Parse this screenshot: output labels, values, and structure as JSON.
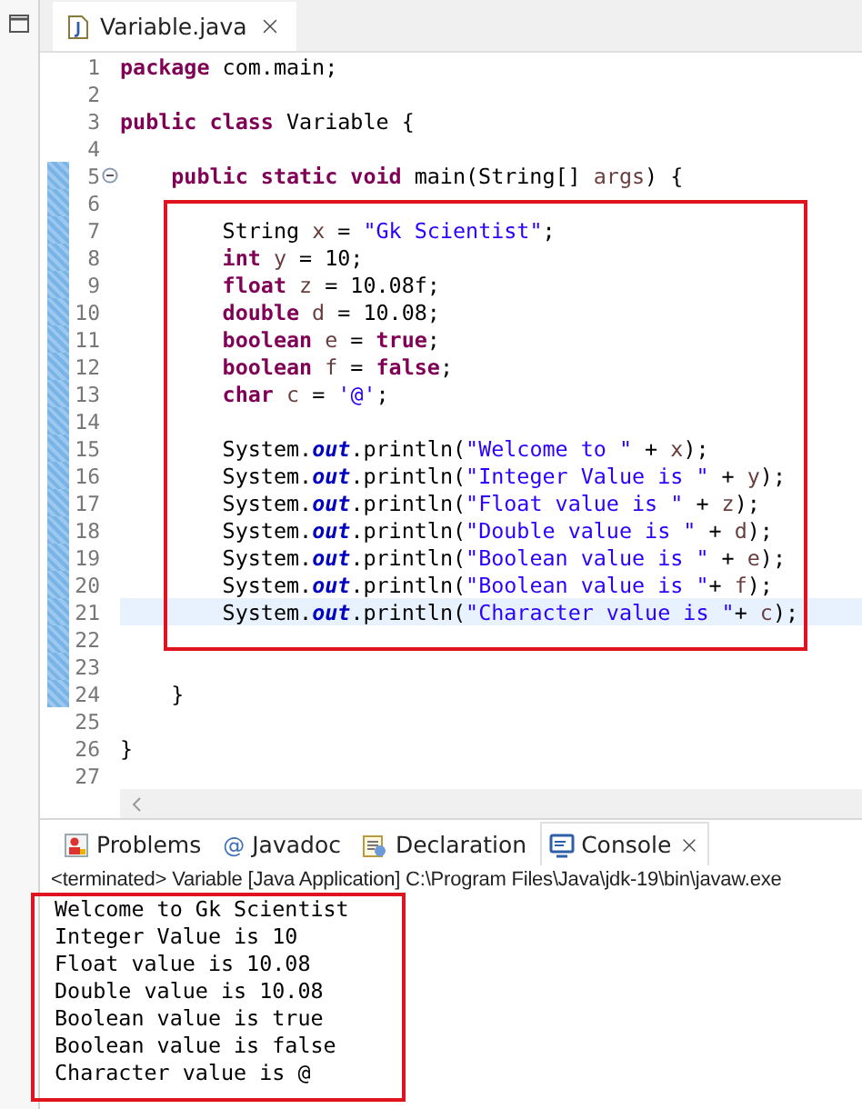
{
  "editor": {
    "tab": {
      "label": "Variable.java",
      "selected": true
    },
    "lines": [
      {
        "number": "1",
        "changed": false,
        "current": false,
        "tokens": [
          {
            "kind": "kw",
            "text": "package"
          },
          {
            "kind": "plain",
            "text": " com.main;"
          }
        ]
      },
      {
        "number": "2",
        "changed": false,
        "current": false
      },
      {
        "number": "3",
        "changed": false,
        "current": false,
        "tokens": [
          {
            "kind": "kw",
            "text": "public class"
          },
          {
            "kind": "plain",
            "text": " Variable {"
          }
        ]
      },
      {
        "number": "4",
        "changed": false,
        "current": false
      },
      {
        "number": "5",
        "changed": true,
        "current": false,
        "foldable": true,
        "tokens": [
          {
            "kind": "kw",
            "text": "    public static void"
          },
          {
            "kind": "plain",
            "text": " main(String[] "
          },
          {
            "kind": "var",
            "text": "args"
          },
          {
            "kind": "plain",
            "text": ") {"
          }
        ]
      },
      {
        "number": "6",
        "changed": true,
        "current": false
      },
      {
        "number": "7",
        "changed": true,
        "current": false,
        "tokens": [
          {
            "kind": "plain",
            "text": "        String "
          },
          {
            "kind": "var",
            "text": "x"
          },
          {
            "kind": "plain",
            "text": " = "
          },
          {
            "kind": "str",
            "text": "\"Gk Scientist\""
          },
          {
            "kind": "plain",
            "text": ";"
          }
        ]
      },
      {
        "number": "8",
        "changed": true,
        "current": false,
        "tokens": [
          {
            "kind": "kw",
            "text": "        int"
          },
          {
            "kind": "var",
            "text": " y"
          },
          {
            "kind": "plain",
            "text": " = 10;"
          }
        ]
      },
      {
        "number": "9",
        "changed": true,
        "current": false,
        "tokens": [
          {
            "kind": "kw",
            "text": "        float"
          },
          {
            "kind": "var",
            "text": " z"
          },
          {
            "kind": "plain",
            "text": " = 10.08f;"
          }
        ]
      },
      {
        "number": "10",
        "changed": true,
        "current": false,
        "tokens": [
          {
            "kind": "kw",
            "text": "        double"
          },
          {
            "kind": "var",
            "text": " d"
          },
          {
            "kind": "plain",
            "text": " = 10.08;"
          }
        ]
      },
      {
        "number": "11",
        "changed": true,
        "current": false,
        "tokens": [
          {
            "kind": "kw",
            "text": "        boolean"
          },
          {
            "kind": "var",
            "text": " e"
          },
          {
            "kind": "plain",
            "text": " = "
          },
          {
            "kind": "kw",
            "text": "true"
          },
          {
            "kind": "plain",
            "text": ";"
          }
        ]
      },
      {
        "number": "12",
        "changed": true,
        "current": false,
        "tokens": [
          {
            "kind": "kw",
            "text": "        boolean"
          },
          {
            "kind": "var",
            "text": " f"
          },
          {
            "kind": "plain",
            "text": " = "
          },
          {
            "kind": "kw",
            "text": "false"
          },
          {
            "kind": "plain",
            "text": ";"
          }
        ]
      },
      {
        "number": "13",
        "changed": true,
        "current": false,
        "tokens": [
          {
            "kind": "kw",
            "text": "        char"
          },
          {
            "kind": "var",
            "text": " c"
          },
          {
            "kind": "plain",
            "text": " = "
          },
          {
            "kind": "str",
            "text": "'@'"
          },
          {
            "kind": "plain",
            "text": ";"
          }
        ]
      },
      {
        "number": "14",
        "changed": true,
        "current": false
      },
      {
        "number": "15",
        "changed": true,
        "current": false,
        "tokens": [
          {
            "kind": "plain",
            "text": "        System."
          },
          {
            "kind": "field",
            "text": "out"
          },
          {
            "kind": "plain",
            "text": ".println("
          },
          {
            "kind": "str",
            "text": "\"Welcome to \""
          },
          {
            "kind": "plain",
            "text": " + "
          },
          {
            "kind": "var",
            "text": "x"
          },
          {
            "kind": "plain",
            "text": ");"
          }
        ]
      },
      {
        "number": "16",
        "changed": true,
        "current": false,
        "tokens": [
          {
            "kind": "plain",
            "text": "        System."
          },
          {
            "kind": "field",
            "text": "out"
          },
          {
            "kind": "plain",
            "text": ".println("
          },
          {
            "kind": "str",
            "text": "\"Integer Value is \""
          },
          {
            "kind": "plain",
            "text": " + "
          },
          {
            "kind": "var",
            "text": "y"
          },
          {
            "kind": "plain",
            "text": ");"
          }
        ]
      },
      {
        "number": "17",
        "changed": true,
        "current": false,
        "tokens": [
          {
            "kind": "plain",
            "text": "        System."
          },
          {
            "kind": "field",
            "text": "out"
          },
          {
            "kind": "plain",
            "text": ".println("
          },
          {
            "kind": "str",
            "text": "\"Float value is \""
          },
          {
            "kind": "plain",
            "text": " + "
          },
          {
            "kind": "var",
            "text": "z"
          },
          {
            "kind": "plain",
            "text": ");"
          }
        ]
      },
      {
        "number": "18",
        "changed": true,
        "current": false,
        "tokens": [
          {
            "kind": "plain",
            "text": "        System."
          },
          {
            "kind": "field",
            "text": "out"
          },
          {
            "kind": "plain",
            "text": ".println("
          },
          {
            "kind": "str",
            "text": "\"Double value is \""
          },
          {
            "kind": "plain",
            "text": " + "
          },
          {
            "kind": "var",
            "text": "d"
          },
          {
            "kind": "plain",
            "text": ");"
          }
        ]
      },
      {
        "number": "19",
        "changed": true,
        "current": false,
        "tokens": [
          {
            "kind": "plain",
            "text": "        System."
          },
          {
            "kind": "field",
            "text": "out"
          },
          {
            "kind": "plain",
            "text": ".println("
          },
          {
            "kind": "str",
            "text": "\"Boolean value is \""
          },
          {
            "kind": "plain",
            "text": " + "
          },
          {
            "kind": "var",
            "text": "e"
          },
          {
            "kind": "plain",
            "text": ");"
          }
        ]
      },
      {
        "number": "20",
        "changed": true,
        "current": false,
        "tokens": [
          {
            "kind": "plain",
            "text": "        System."
          },
          {
            "kind": "field",
            "text": "out"
          },
          {
            "kind": "plain",
            "text": ".println("
          },
          {
            "kind": "str",
            "text": "\"Boolean value is \""
          },
          {
            "kind": "plain",
            "text": "+ "
          },
          {
            "kind": "var",
            "text": "f"
          },
          {
            "kind": "plain",
            "text": ");"
          }
        ]
      },
      {
        "number": "21",
        "changed": true,
        "current": true,
        "tokens": [
          {
            "kind": "plain",
            "text": "        System."
          },
          {
            "kind": "field",
            "text": "out"
          },
          {
            "kind": "plain",
            "text": ".println("
          },
          {
            "kind": "str",
            "text": "\"Character value is \""
          },
          {
            "kind": "plain",
            "text": "+ "
          },
          {
            "kind": "var",
            "text": "c"
          },
          {
            "kind": "plain",
            "text": ");"
          }
        ]
      },
      {
        "number": "22",
        "changed": true,
        "current": false
      },
      {
        "number": "23",
        "changed": true,
        "current": false
      },
      {
        "number": "24",
        "changed": true,
        "current": false,
        "tokens": [
          {
            "kind": "plain",
            "text": "    }"
          }
        ]
      },
      {
        "number": "25",
        "changed": false,
        "current": false
      },
      {
        "number": "26",
        "changed": false,
        "current": false,
        "tokens": [
          {
            "kind": "plain",
            "text": "}"
          }
        ]
      },
      {
        "number": "27",
        "changed": false,
        "current": false
      }
    ]
  },
  "console": {
    "tabs": [
      {
        "label": "Problems",
        "kind": "problems",
        "selected": false
      },
      {
        "label": "Javadoc",
        "kind": "javadoc",
        "glyph": "@",
        "selected": false
      },
      {
        "label": "Declaration",
        "kind": "declaration",
        "selected": false
      },
      {
        "label": "Console",
        "kind": "console",
        "selected": true
      }
    ],
    "status": "<terminated> Variable [Java Application] C:\\Program Files\\Java\\jdk-19\\bin\\javaw.exe",
    "output": [
      "Welcome to Gk Scientist",
      "Integer Value is 10",
      "Float value is 10.08",
      "Double value is 10.08",
      "Boolean value is true",
      "Boolean value is false",
      "Character value is @"
    ]
  }
}
